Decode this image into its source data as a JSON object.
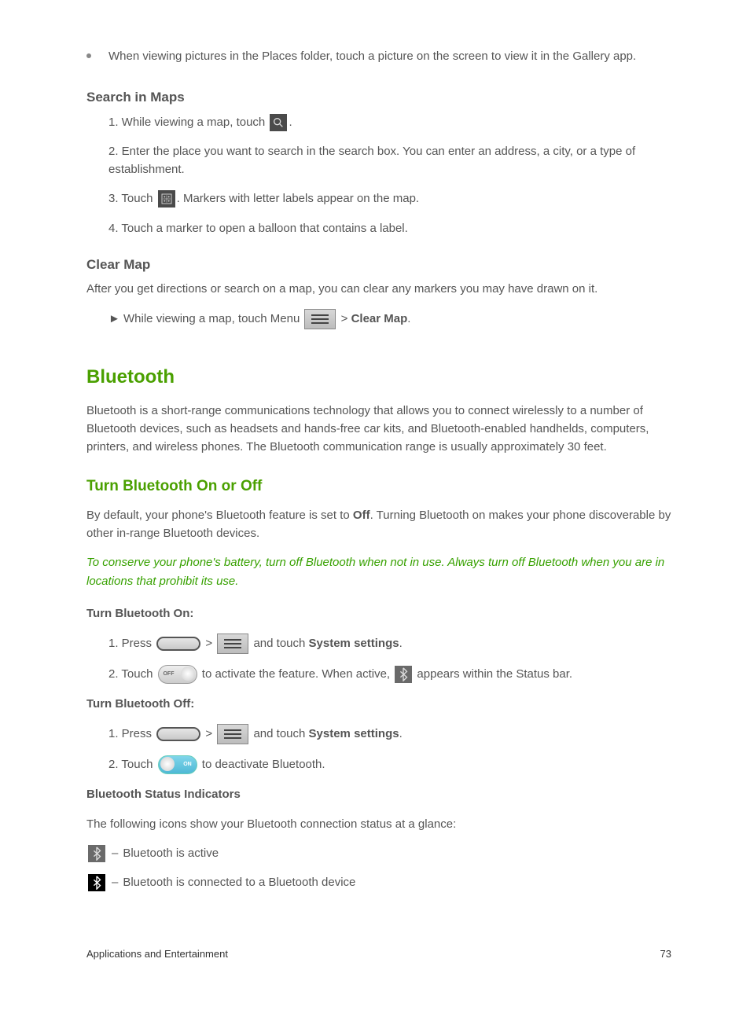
{
  "bullet": {
    "intro": "When viewing pictures in the Places folder, touch a picture on the screen to view it in the Gallery app."
  },
  "sections": {
    "search_title": "Search in Maps",
    "search_steps": {
      "s1a": "1. While viewing a map, touch ",
      "s1b": ".",
      "s2": "2. Enter the place you want to search in the search box. You can enter an address, a city, or a type of establishment.",
      "s3a": "3. Touch ",
      "s3b": ". Markers with letter labels appear on the map.",
      "s4": "4. Touch a marker to open a balloon that contains a label."
    },
    "clear_title": "Clear Map",
    "clear_text": "After you get directions or search on a map, you can clear any markers you may have drawn on it.",
    "clear_step_a": "While viewing a map, touch Menu ",
    "clear_step_b": " > ",
    "clear_step_c": "Clear Map",
    "clear_step_d": "."
  },
  "bt": {
    "heading": "Bluetooth",
    "intro": "Bluetooth is a short-range communications technology that allows you to connect wirelessly to a number of Bluetooth devices, such as headsets and hands-free car kits, and Bluetooth-enabled handhelds, computers, printers, and wireless phones. The Bluetooth communication range is usually approximately 30 feet.",
    "onoff_heading": "Turn Bluetooth On or Off",
    "onoff_default_a": "By default, your phone's Bluetooth feature is set to ",
    "onoff_default_b": "Off",
    "onoff_default_c": ". Turning Bluetooth on makes your phone discoverable by other in-range Bluetooth devices.",
    "tip": "To conserve your phone's battery, turn off Bluetooth when not in use. Always turn off Bluetooth when you are in locations that prohibit its use.",
    "turnon_label": "Turn Bluetooth On:",
    "on_s1a": "1. Press ",
    "on_s1b": " > ",
    "on_s1c": " and touch ",
    "on_s1d": "System settings",
    "on_s1e": ".",
    "on_s2a": "2. Touch ",
    "on_s2b": " to activate the feature. When active, ",
    "on_s2c": " appears within the Status bar.",
    "turnoff_label": "Turn Bluetooth Off:",
    "off_s1a": "1. Press ",
    "off_s1b": " > ",
    "off_s1c": " and touch ",
    "off_s1d": "System settings",
    "off_s1e": ".",
    "off_s2a": "2. Touch ",
    "off_s2b": " to deactivate Bluetooth.",
    "status_heading": "Bluetooth Status Indicators",
    "status_intro": "The following icons show your Bluetooth connection status at a glance:",
    "ind1": "Bluetooth is active",
    "ind2": "Bluetooth is connected to a Bluetooth device"
  },
  "footer": {
    "left": "Applications and Entertainment",
    "right": "73"
  },
  "toggle_labels": {
    "off": "OFF",
    "on": "ON"
  }
}
